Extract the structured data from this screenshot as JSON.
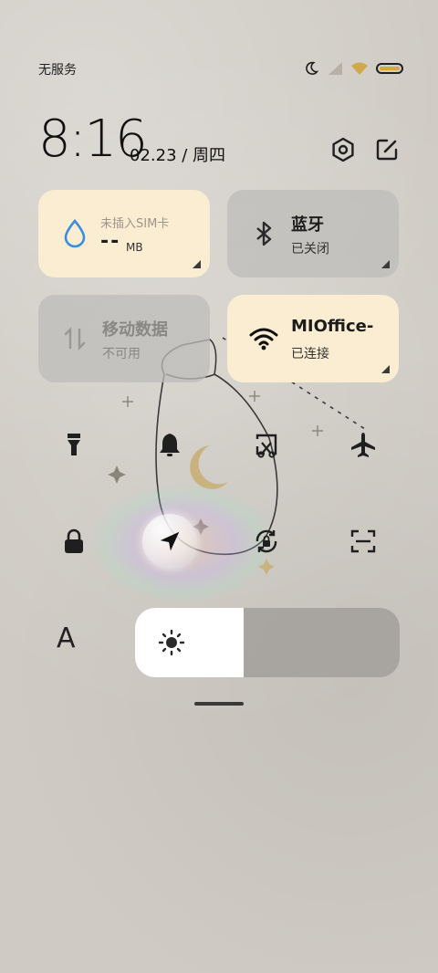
{
  "status_bar": {
    "carrier": "无服务",
    "icons": [
      "moon-icon",
      "signal-icon",
      "wifi-icon",
      "battery-icon"
    ]
  },
  "header": {
    "time": "8:16",
    "date": "02.23 / 周四",
    "icons": [
      "settings-icon",
      "edit-icon"
    ]
  },
  "tiles": {
    "data_usage": {
      "sim_label": "未插入SIM卡",
      "value": "--",
      "unit": "MB",
      "state": "on"
    },
    "bluetooth": {
      "title": "蓝牙",
      "status": "已关闭",
      "state": "off"
    },
    "mobile_data": {
      "title": "移动数据",
      "status": "不可用",
      "state": "disabled"
    },
    "wifi": {
      "title": "MIOffice-",
      "status": "已连接",
      "state": "on"
    }
  },
  "quick_toggles": [
    {
      "name": "flashlight-icon"
    },
    {
      "name": "bell-icon"
    },
    {
      "name": "screenshot-icon"
    },
    {
      "name": "airplane-icon"
    },
    {
      "name": "lock-icon"
    },
    {
      "name": "location-icon"
    },
    {
      "name": "rotation-lock-icon"
    },
    {
      "name": "scan-icon"
    }
  ],
  "font_button": "A",
  "brightness": {
    "level": 0.41
  },
  "colors": {
    "tile_on": "#fbedd1",
    "tile_off": "#bebcba",
    "accent_blue": "#3a8de0"
  }
}
